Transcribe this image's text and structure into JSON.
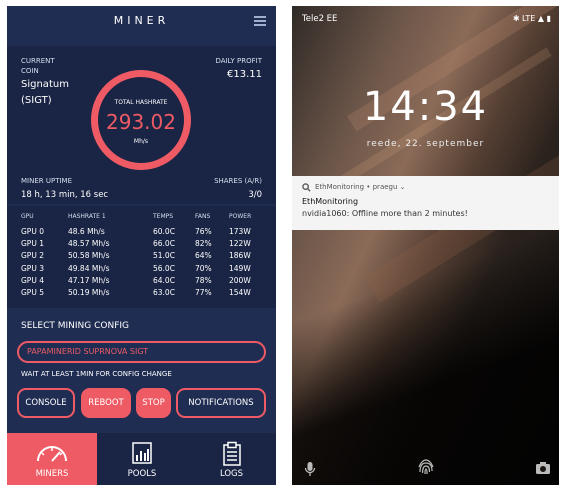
{
  "miner_app": {
    "title": "MINER",
    "current_coin_label_line1": "CURRENT",
    "current_coin_label_line2": "COIN",
    "coin_name": "Signatum",
    "coin_ticker": "(SIGT)",
    "daily_profit_label": "DAILY PROFIT",
    "daily_profit_value": "€13.11",
    "total_hashrate_label": "TOTAL HASHRATE",
    "total_hashrate_value": "293.02",
    "total_hashrate_unit": "Mh/s",
    "uptime_label": "MINER UPTIME",
    "uptime_value": "18 h, 13 min, 16 sec",
    "shares_label": "SHARES (A/R)",
    "shares_value": "3/0",
    "gpu_table": {
      "headers": [
        "GPU",
        "HASHRATE 1",
        "TEMPS",
        "FANS",
        "POWER"
      ],
      "rows": [
        [
          "GPU 0",
          "48.6 Mh/s",
          "60.0C",
          "76%",
          "173W"
        ],
        [
          "GPU 1",
          "48.57 Mh/s",
          "66.0C",
          "82%",
          "122W"
        ],
        [
          "GPU 2",
          "50.58 Mh/s",
          "51.0C",
          "64%",
          "186W"
        ],
        [
          "GPU 3",
          "49.84 Mh/s",
          "56.0C",
          "70%",
          "149W"
        ],
        [
          "GPU 4",
          "47.17 Mh/s",
          "64.0C",
          "78%",
          "200W"
        ],
        [
          "GPU 5",
          "50.19 Mh/s",
          "63.0C",
          "77%",
          "154W"
        ]
      ]
    },
    "select_config_label": "SELECT MINING CONFIG",
    "selected_config": "PAPAMINERID SUPRNOVA SIGT",
    "wait_note": "WAIT AT LEAST 1MIN FOR CONFIG CHANGE",
    "buttons": {
      "console": "CONSOLE",
      "reboot": "REBOOT",
      "stop": "STOP",
      "notifications": "NOTIFICATIONS"
    },
    "nav": {
      "miners": "MINERS",
      "pools": "POOLS",
      "logs": "LOGS"
    },
    "colors": {
      "background": "#1f2d52",
      "panel": "#1a2545",
      "accent": "#ef5b64"
    }
  },
  "lock_screen": {
    "carrier": "Tele2 EE",
    "status_icons": "✱ LTE ▲ ▮",
    "time": "14:34",
    "date": "reede, 22. september",
    "notification": {
      "app": "EthMonitoring • praegu ⌄",
      "title": "EthMonitoring",
      "body": "nvidia1060: Offline more than 2 minutes!"
    }
  }
}
